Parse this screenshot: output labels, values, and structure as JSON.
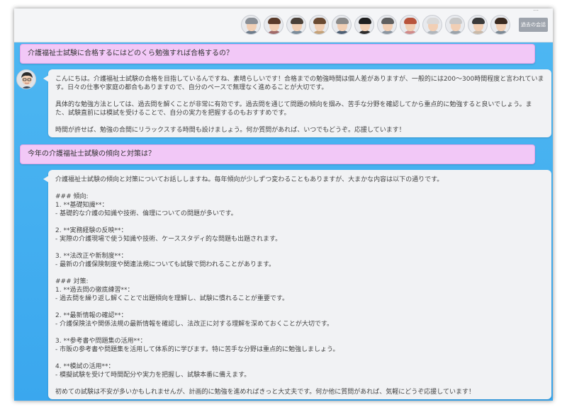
{
  "header": {
    "note": "...",
    "avatars": [
      {
        "name": "character-1",
        "hair": "#8a8f96",
        "body": "#6d7c8c"
      },
      {
        "name": "character-2",
        "hair": "#5a3b2a",
        "body": "#a06a6a"
      },
      {
        "name": "character-3",
        "hair": "#4a4038",
        "body": "#7a8b9a"
      },
      {
        "name": "character-4",
        "hair": "#6a4a32",
        "body": "#c4a27a"
      },
      {
        "name": "character-5",
        "hair": "#8a8a8a",
        "body": "#4d5f74"
      },
      {
        "name": "character-6",
        "hair": "#1f1f1f",
        "body": "#2c2c2c"
      },
      {
        "name": "character-7",
        "hair": "#5f5f5f",
        "body": "#8a95a0"
      },
      {
        "name": "character-8",
        "hair": "#b8543c",
        "body": "#d08b8b"
      },
      {
        "name": "character-9",
        "hair": "#d9d9d9",
        "body": "#b0b6bc"
      },
      {
        "name": "character-10",
        "hair": "#c8c8c8",
        "body": "#9aa3ab"
      },
      {
        "name": "character-11",
        "hair": "#3a3a3a",
        "body": "#c9b9a8"
      },
      {
        "name": "character-12",
        "hair": "#3a2a20",
        "body": "#7c8a96"
      }
    ],
    "past_button_label": "過去の会話"
  },
  "conversation": [
    {
      "question": "介護福祉士試験に合格するにはどのくら勉強すれば合格するの？",
      "answer_paragraphs": [
        "こんにちは。介護福祉士試験の合格を目指しているんですね、素晴らしいです！合格までの勉強時間は個人差がありますが、一般的には200〜300時間程度と言われています。日々の仕事や家庭の都合もありますので、自分のペースで無理なく進めることが大切です。",
        "具体的な勉強方法としては、過去問を解くことが非常に有効です。過去問を通じて問題の傾向を掴み、苦手な分野を確認してから重点的に勉強すると良いでしょう。また、試験直前には模試を受けることで、自分の実力を把握するのもおすすめです。",
        "時間が許せば、勉強の合間にリラックスする時間も設けましょう。何か質問があれば、いつでもどうぞ。応援しています！"
      ]
    },
    {
      "question": "今年の介護福祉士試験の傾向と対策は？",
      "answer_paragraphs": [
        "介護福祉士試験の傾向と対策についてお話ししますね。毎年傾向が少しずつ変わることもありますが、大まかな内容は以下の通りです。",
        "### 傾向:\n1. **基礎知識**：\n- 基礎的な介護の知識や技術、倫理についての問題が多いです。",
        "2. **実務経験の反映**：\n- 実際の介護現場で使う知識や技術、ケーススタディ的な問題も出題されます。",
        "3. **法改正や新制度**：\n- 最新の介護保険制度や関連法規についても試験で問われることがあります。",
        "### 対策:\n1. **過去問の徹底練習**：\n- 過去問を繰り返し解くことで出題傾向を理解し、試験に慣れることが重要です。",
        "2. **最新情報の確認**：\n- 介護保険法や関係法規の最新情報を確認し、法改正に対する理解を深めておくことが大切です。",
        "3. **参考書や問題集の活用**：\n- 市販の参考書や問題集を活用して体系的に学びます。特に苦手な分野は重点的に勉強しましょう。",
        "4. **模試の活用**：\n- 模擬試験を受けて時間配分や実力を把握し、試験本番に備えます。",
        "初めての試験は不安が多いかもしれませんが、計画的に勉強を進めればきっと大丈夫です。何か他に質問があれば、気軽にどうぞ応援しています！"
      ]
    }
  ],
  "colors": {
    "background": "#3aa7ee",
    "question_bubble": "#f2c8f7",
    "answer_bubble": "#f1f2f4"
  }
}
